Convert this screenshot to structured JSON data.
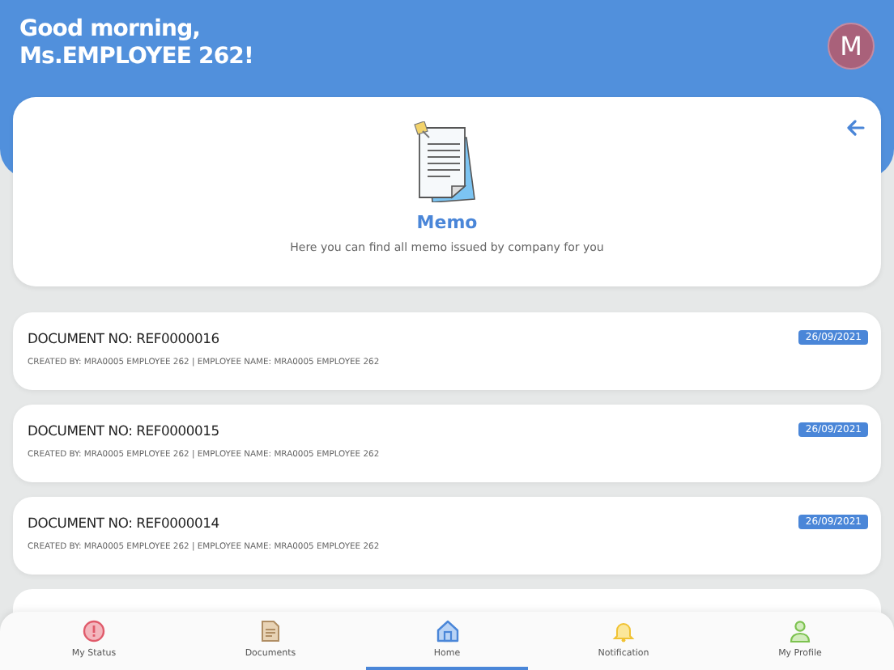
{
  "header": {
    "greeting": "Good morning,",
    "name": "Ms.EMPLOYEE 262!",
    "avatar_letter": "M"
  },
  "memo_card": {
    "title": "Memo",
    "subtitle": "Here you can find all memo issued by company for you"
  },
  "documents": [
    {
      "title": "DOCUMENT NO: REF0000016",
      "meta": "CREATED BY: MRA0005 EMPLOYEE 262 | EMPLOYEE NAME: MRA0005 EMPLOYEE 262",
      "date": "26/09/2021"
    },
    {
      "title": "DOCUMENT NO: REF0000015",
      "meta": "CREATED BY: MRA0005 EMPLOYEE 262 | EMPLOYEE NAME: MRA0005 EMPLOYEE 262",
      "date": "26/09/2021"
    },
    {
      "title": "DOCUMENT NO: REF0000014",
      "meta": "CREATED BY: MRA0005 EMPLOYEE 262 | EMPLOYEE NAME: MRA0005 EMPLOYEE 262",
      "date": "26/09/2021"
    }
  ],
  "bottom_nav": [
    {
      "label": "My Status",
      "selected": false
    },
    {
      "label": "Documents",
      "selected": false
    },
    {
      "label": "Home",
      "selected": true
    },
    {
      "label": "Notification",
      "selected": false
    },
    {
      "label": "My Profile",
      "selected": false
    }
  ]
}
